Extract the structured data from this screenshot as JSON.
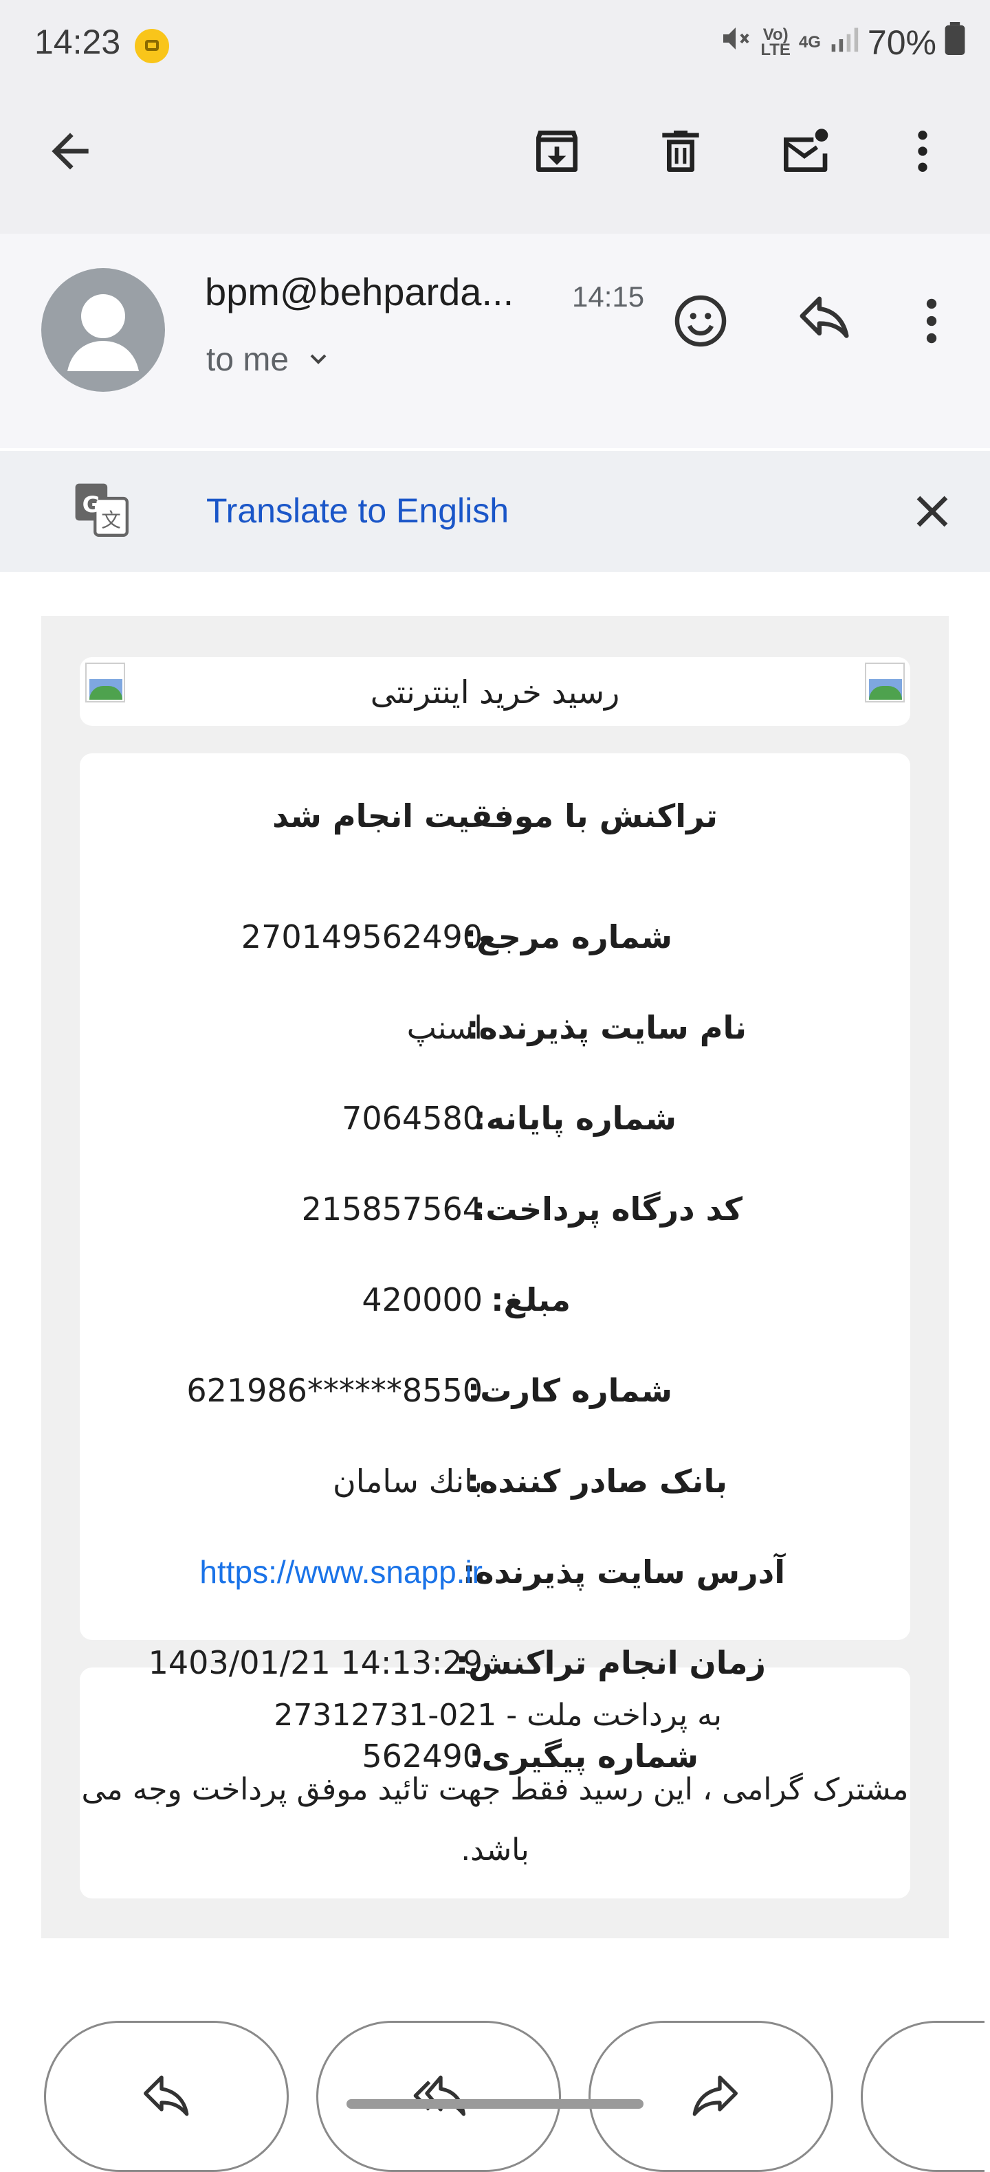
{
  "status_bar": {
    "time": "14:23",
    "battery": "70%",
    "network_label_top": "Vo)",
    "network_label_bottom": "LTE",
    "network_type": "4G",
    "icons": [
      "youtube-notification-icon",
      "mute-icon",
      "signal-icon",
      "battery-icon"
    ]
  },
  "toolbar": {
    "icons": [
      "back-arrow-icon",
      "archive-icon",
      "delete-icon",
      "mark-unread-icon",
      "more-vert-icon"
    ]
  },
  "email": {
    "sender": "bpm@behparda...",
    "time": "14:15",
    "to": "to me"
  },
  "translate": {
    "link": "Translate to English"
  },
  "receipt": {
    "banner_title": "رسید خرید اینترنتی",
    "title": "تراکنش با موفقیت انجام شد",
    "rows": [
      {
        "label": "شماره مرجع:",
        "value": "270149562490"
      },
      {
        "label": "نام سایت پذیرنده:",
        "value": "اسنپ"
      },
      {
        "label": "شماره پایانه:",
        "value": "7064580"
      },
      {
        "label": "کد درگاه پرداخت:",
        "value": "215857564"
      },
      {
        "label": "مبلغ:",
        "value": "420000"
      },
      {
        "label": "شماره کارت:",
        "value": "621986******8550"
      },
      {
        "label": "بانک صادر کننده:",
        "value": "بانك سامان"
      },
      {
        "label": "آدرس سایت پذیرنده:",
        "value": "https://www.snapp.ir"
      },
      {
        "label": "زمان انجام تراکنش:",
        "value": "1403/01/21 14:13:29"
      },
      {
        "label": "شماره پیگیری:",
        "value": "562490"
      }
    ],
    "support_line": "به پرداخت ملت - 021-27312731",
    "footer_note": "مشترک گرامی ، این رسید فقط جهت تائید موفق پرداخت وجه می باشد."
  },
  "bottom_actions": [
    "reply",
    "reply-all",
    "forward"
  ],
  "colors": {
    "link": "#1a56c8",
    "url": "#1a73e8",
    "avatar": "#9aa0a6",
    "toolbar_bg": "#efeff2"
  }
}
